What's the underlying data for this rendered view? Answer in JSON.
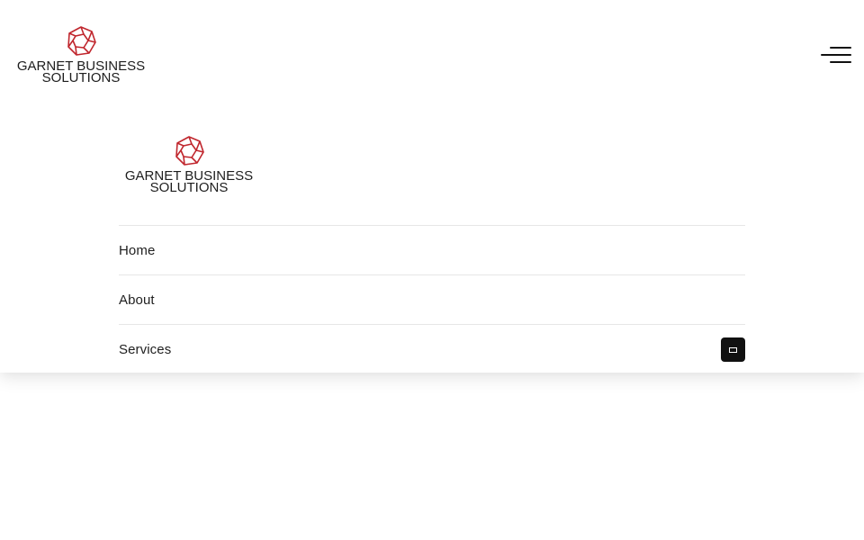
{
  "header": {
    "logo": {
      "line1": "GARNET BUSINESS",
      "line2": "SOLUTIONS"
    },
    "menu_toggle_icon": "hamburger-icon"
  },
  "dropdown": {
    "logo": {
      "line1": "GARNET BUSINESS",
      "line2": "SOLUTIONS"
    },
    "nav_items": [
      {
        "label": "Home"
      },
      {
        "label": "About"
      },
      {
        "label": "Services",
        "has_submenu": true
      }
    ],
    "submenu_toggle_icon": "submenu-expand-icon"
  },
  "colors": {
    "brand_red": "#c0262d",
    "text": "#1f1f1f",
    "divider": "#e6e6e6",
    "toggle_bg": "#111111"
  }
}
